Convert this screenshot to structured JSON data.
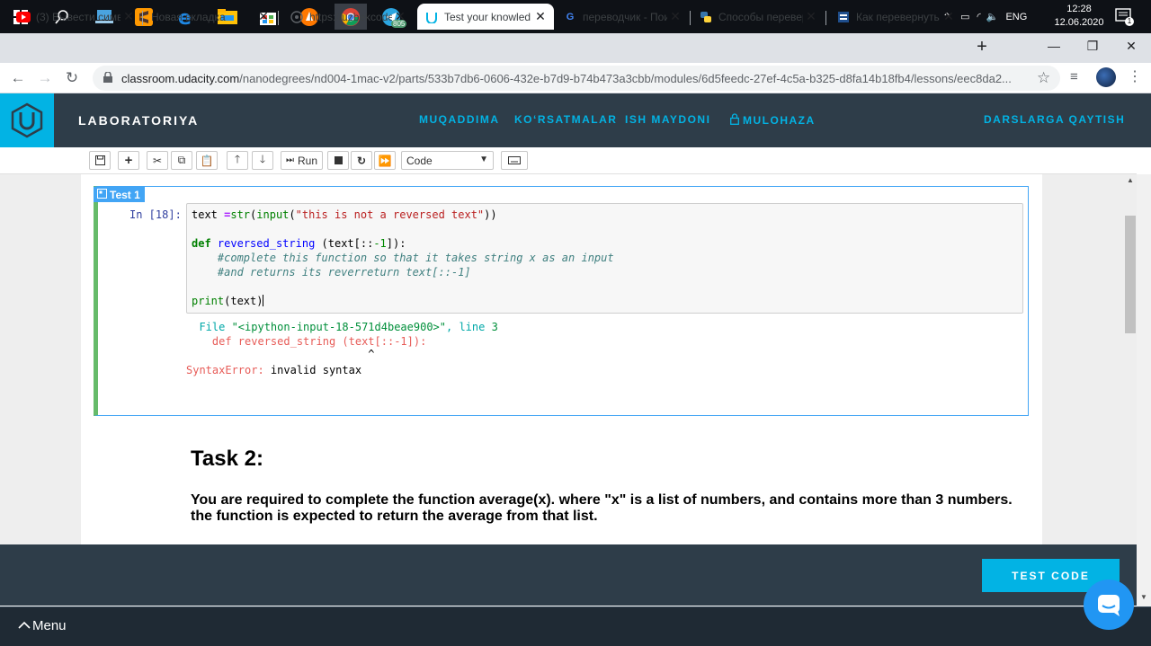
{
  "taskbar": {
    "telegram_badge": "805",
    "language": "ENG",
    "time": "12:28",
    "date": "12.06.2020",
    "notification_count": "1"
  },
  "browser": {
    "tabs": [
      {
        "label": "(3) Вывести симво",
        "favicon": "youtube-icon"
      },
      {
        "label": "Новая вкладка",
        "favicon": "none"
      },
      {
        "label": "https://uzbekcode",
        "favicon": "globe-icon"
      },
      {
        "label": "Test your knowled",
        "favicon": "udacity-icon"
      },
      {
        "label": "переводчик - Пои",
        "favicon": "google-icon"
      },
      {
        "label": "Способы перевер",
        "favicon": "python-icon"
      },
      {
        "label": "Как перевернуть",
        "favicon": "stackoverflow-icon"
      }
    ],
    "new_tab": "+",
    "url_host": "classroom.udacity.com",
    "url_path": "/nanodegrees/nd004-1mac-v2/parts/533b7db6-0606-432e-b7d9-b74b473a3cbb/modules/6d5feedc-27ef-4c5a-b325-d8fa14b18fb4/lessons/eec8da2..."
  },
  "header": {
    "title": "LABORATORIYA",
    "nav": [
      "MUQADDIMA",
      "KO‘RSATMALAR",
      "ISH MAYDONI",
      "MULOHAZA"
    ],
    "back": "DARSLARGA QAYTISH"
  },
  "toolbar": {
    "run_label": "Run",
    "cell_type": "Code"
  },
  "cell": {
    "tag": "Test 1",
    "prompt": "In [18]:",
    "code": {
      "line1_a": "text ",
      "line1_b": "=",
      "line1_c": "str",
      "line1_d": "(",
      "line1_e": "input",
      "line1_f": "(",
      "line1_g": "\"this is not a reversed text\"",
      "line1_h": "))",
      "line2_kw": "def",
      "line2_fn": "reversed_string",
      "line2_a": " (text[::",
      "line2_num": "-1",
      "line2_b": "]):",
      "line3": "    #complete this function so that it takes string x as an input",
      "line4": "    #and returns its reverreturn text[::-1]",
      "line5_fn": "print",
      "line5_rest": "(text)"
    },
    "output": {
      "file_prefix": "  File ",
      "file_name": "\"<ipython-input-18-571d4beae900>\"",
      "file_suffix": ", line ",
      "line_no": "3",
      "err_code": "    def reversed_string (text[::-1]):",
      "caret": "                            ^",
      "error_name": "SyntaxError:",
      "error_msg": " invalid syntax"
    }
  },
  "task": {
    "title": "Task 2:",
    "description": "You are required to complete the function average(x). where \"x\" is a list of numbers, and contains more than 3 numbers. the function is expected to return the average from that list."
  },
  "footer": {
    "test_code": "TEST CODE",
    "menu": "Menu"
  }
}
